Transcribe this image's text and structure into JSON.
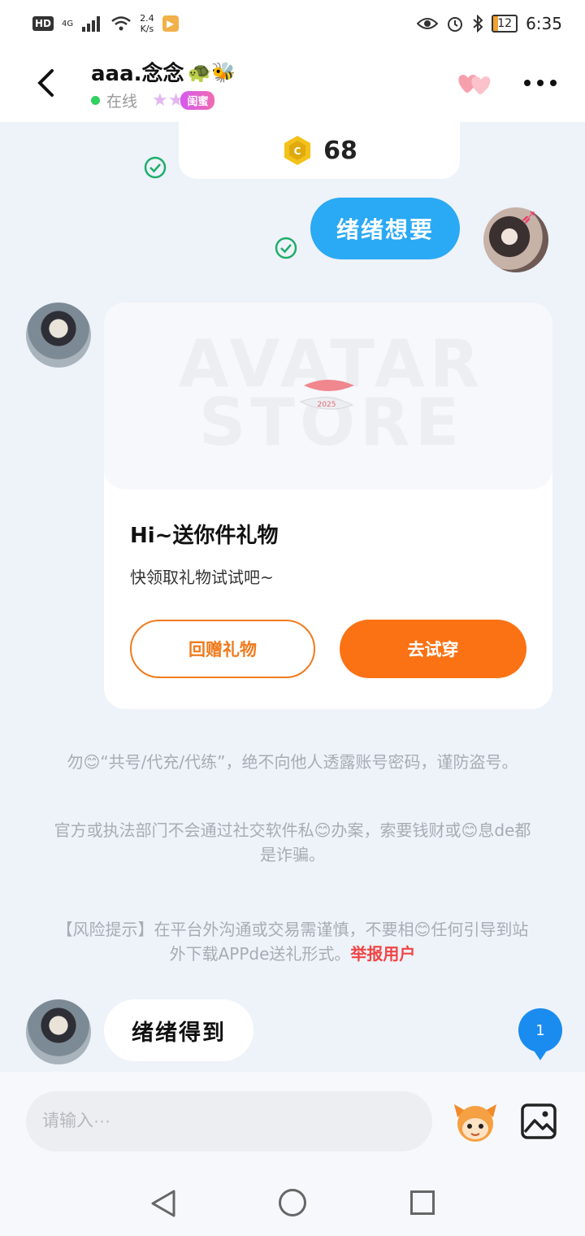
{
  "status_bar": {
    "network_badge": "HD",
    "signal_label": "4G",
    "speed_value": "2.4",
    "speed_unit": "K/s",
    "battery": "12",
    "time": "6:35"
  },
  "header": {
    "contact_name": "aaa.念念",
    "name_emojis": "🐢🐝",
    "online_status": "在线",
    "relation_badge": "闺蜜"
  },
  "chat": {
    "coin_value": "68",
    "my_message": "绪绪想要",
    "gift_card": {
      "watermark_line1": "AVATAR",
      "watermark_line2": "STORE",
      "item_label": "2025",
      "title": "Hi~送你件礼物",
      "subtitle": "快领取礼物试试吧~",
      "return_gift_button": "回赠礼物",
      "try_on_button": "去试穿"
    },
    "notice_1": "勿😊“共号/代充/代练”，绝不向他人透露账号密码，谨防盗号。",
    "notice_2": "官方或执法部门不会通过社交软件私😊办案，索要钱财或😊息de都是诈骗。",
    "notice_3_text": "【风险提示】在平台外沟通或交易需谨慎，不要相😊任何引导到站外下载APPde送礼形式。",
    "report_link": "举报用户",
    "other_message": "绪绪得到",
    "unread_count": "1"
  },
  "input_bar": {
    "placeholder": "请输入···"
  },
  "colors": {
    "accent_blue": "#2aa9f4",
    "accent_orange": "#fb7214",
    "report_red": "#f04545",
    "online_green": "#2ed15e"
  },
  "icons": {
    "back": "back-arrow-icon",
    "heart": "double-heart-icon",
    "more": "more-dots-icon",
    "coin": "coin-icon",
    "check": "check-circle-icon",
    "emoji": "emoji-mascot-icon",
    "image": "image-icon"
  }
}
